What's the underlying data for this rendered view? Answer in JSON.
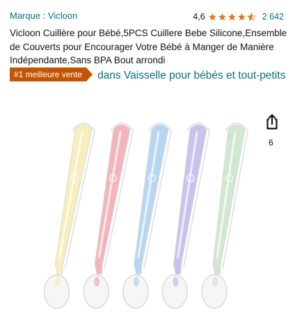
{
  "product": {
    "brand": "Marque : Vicloon",
    "rating": "4,6",
    "stars": 4.6,
    "review_count": "2 642",
    "title": "Vicloon Cuillère pour Bébé,5PCS Cuillere Bebe Silicone,Ensemble de Couverts pour Encourager Votre Bébé à Manger de Manière Indépendante,Sans BPA Bout arrondi",
    "badge": "#1 meilleure vente",
    "badge_category": "dans Vaisselle pour bébés et tout-petits",
    "share_count": "6"
  },
  "colors": {
    "link": "#007185",
    "badge": "#c45500",
    "star": "#de7921"
  },
  "spoon_colors": [
    "#f7eebb",
    "#f3b5bd",
    "#b6d6f2",
    "#c8c3ec",
    "#cfe8cf"
  ],
  "icons": [
    "star-icon",
    "share-icon"
  ]
}
